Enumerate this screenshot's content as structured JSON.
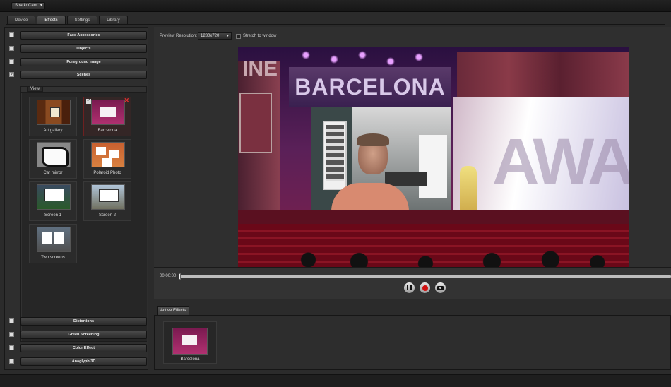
{
  "app": {
    "menu_label": "SparkoCam"
  },
  "tabs": [
    {
      "label": "Device"
    },
    {
      "label": "Effects"
    },
    {
      "label": "Settings"
    },
    {
      "label": "Library"
    }
  ],
  "accordion_top": [
    {
      "label": "Face Accessories",
      "checked": false
    },
    {
      "label": "Objects",
      "checked": false
    },
    {
      "label": "Foreground Image",
      "checked": false
    },
    {
      "label": "Scenes",
      "checked": true
    }
  ],
  "view": {
    "label": "View",
    "scenes": [
      {
        "label": "Art gallery",
        "thumb": "art-gallery-thumbnail"
      },
      {
        "label": "Barcelona",
        "thumb": "barcelona-thumbnail",
        "selected": true,
        "checked": true
      },
      {
        "label": "Car mirror",
        "thumb": "car-mirror-thumbnail"
      },
      {
        "label": "Polaroid Photo",
        "thumb": "polaroid-thumbnail"
      },
      {
        "label": "Screen 1",
        "thumb": "screen-1-thumbnail"
      },
      {
        "label": "Screen 2",
        "thumb": "screen-2-thumbnail"
      },
      {
        "label": "Two screens",
        "thumb": "two-screens-thumbnail"
      }
    ]
  },
  "accordion_bottom": [
    {
      "label": "Distortions",
      "checked": false
    },
    {
      "label": "Green Screening",
      "checked": false
    },
    {
      "label": "Color Effect",
      "checked": false
    },
    {
      "label": "Anaglyph 3D",
      "checked": false
    }
  ],
  "preview": {
    "resolution_label": "Preview Resolution:",
    "resolution_value": "1280x720",
    "stretch_label": "Stretch to window",
    "video_text_main": "BARCELONA",
    "video_text_left": "INE",
    "video_text_right": "AWA"
  },
  "playback": {
    "timecode": "00:00:00",
    "progress": 0
  },
  "active_effects": {
    "tab_label": "Active Effects",
    "items": [
      {
        "label": "Barcelona"
      }
    ]
  },
  "colors": {
    "background": "#2b2b2b",
    "record": "#d01010",
    "selected_border": "#6e2020"
  }
}
